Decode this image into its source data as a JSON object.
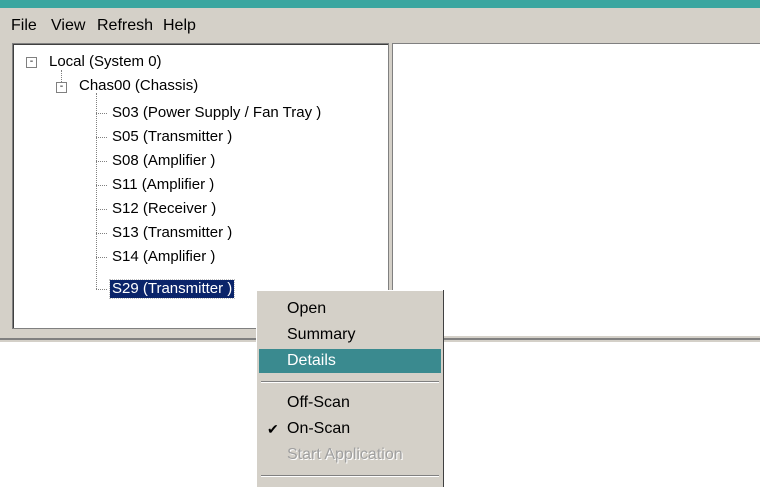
{
  "menubar": {
    "items": [
      "File",
      "View",
      "Refresh",
      "Help"
    ]
  },
  "tree": {
    "root": {
      "label": "Local (System 0)",
      "expander": "-"
    },
    "chassis": {
      "label": "Chas00 (Chassis)",
      "expander": "-"
    },
    "slots": [
      "S03 (Power Supply / Fan Tray )",
      "S05 (Transmitter )",
      "S08 (Amplifier )",
      "S11 (Amplifier )",
      "S12 (Receiver )",
      "S13 (Transmitter )",
      "S14 (Amplifier )",
      "S29 (Transmitter )"
    ],
    "selected": "S29 (Transmitter )"
  },
  "context_menu": {
    "open": "Open",
    "summary": "Summary",
    "details": "Details",
    "off_scan": "Off-Scan",
    "on_scan": "On-Scan",
    "start_application": "Start Application",
    "check_glyph": "✔",
    "highlight_color": "#3a8a8f"
  }
}
